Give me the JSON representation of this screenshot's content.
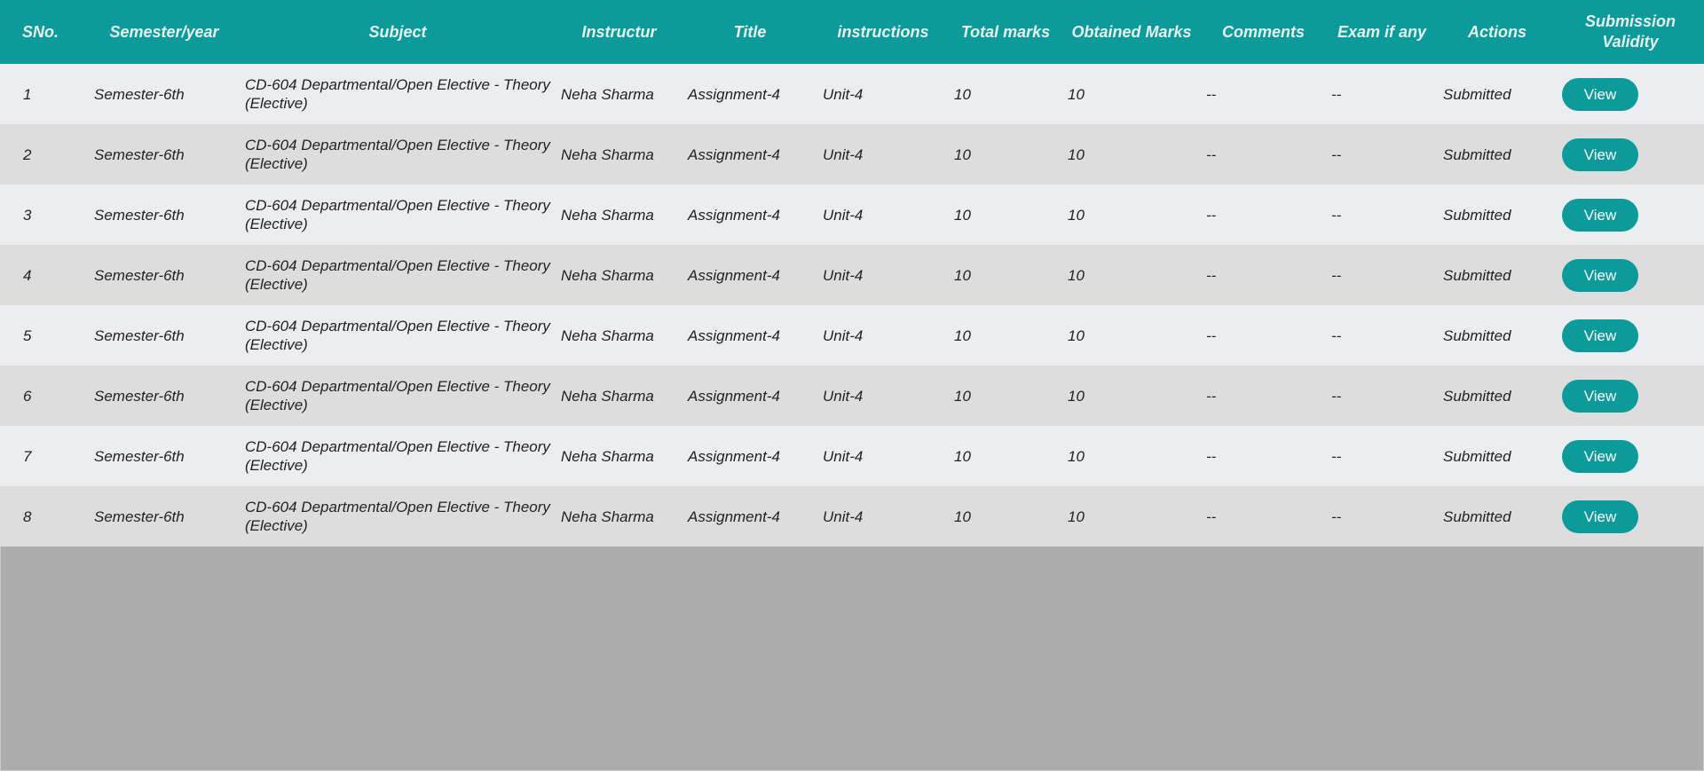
{
  "table": {
    "headers": [
      "SNo.",
      "Semester/year",
      "Subject",
      "Instructur",
      "Title",
      "instructions",
      "Total marks",
      "Obtained Marks",
      "Comments",
      "Exam if any",
      "Actions",
      "Submission Validity"
    ],
    "rows": [
      {
        "sno": "1",
        "semester": "Semester-6th",
        "subject": "CD-604 Departmental/Open Elective - Theory (Elective)",
        "instructor": "Neha Sharma",
        "title": "Assignment-4",
        "instructions": "Unit-4",
        "total": "10",
        "obtained": "10",
        "comments": "--",
        "exam": "--",
        "actions": "Submitted",
        "validity_button": "View"
      },
      {
        "sno": "2",
        "semester": "Semester-6th",
        "subject": "CD-604 Departmental/Open Elective - Theory (Elective)",
        "instructor": "Neha Sharma",
        "title": "Assignment-4",
        "instructions": "Unit-4",
        "total": "10",
        "obtained": "10",
        "comments": "--",
        "exam": "--",
        "actions": "Submitted",
        "validity_button": "View"
      },
      {
        "sno": "3",
        "semester": "Semester-6th",
        "subject": "CD-604 Departmental/Open Elective - Theory (Elective)",
        "instructor": "Neha Sharma",
        "title": "Assignment-4",
        "instructions": "Unit-4",
        "total": "10",
        "obtained": "10",
        "comments": "--",
        "exam": "--",
        "actions": "Submitted",
        "validity_button": "View"
      },
      {
        "sno": "4",
        "semester": "Semester-6th",
        "subject": "CD-604 Departmental/Open Elective - Theory (Elective)",
        "instructor": "Neha Sharma",
        "title": "Assignment-4",
        "instructions": "Unit-4",
        "total": "10",
        "obtained": "10",
        "comments": "--",
        "exam": "--",
        "actions": "Submitted",
        "validity_button": "View"
      },
      {
        "sno": "5",
        "semester": "Semester-6th",
        "subject": "CD-604 Departmental/Open Elective - Theory (Elective)",
        "instructor": "Neha Sharma",
        "title": "Assignment-4",
        "instructions": "Unit-4",
        "total": "10",
        "obtained": "10",
        "comments": "--",
        "exam": "--",
        "actions": "Submitted",
        "validity_button": "View"
      },
      {
        "sno": "6",
        "semester": "Semester-6th",
        "subject": "CD-604 Departmental/Open Elective - Theory (Elective)",
        "instructor": "Neha Sharma",
        "title": "Assignment-4",
        "instructions": "Unit-4",
        "total": "10",
        "obtained": "10",
        "comments": "--",
        "exam": "--",
        "actions": "Submitted",
        "validity_button": "View"
      },
      {
        "sno": "7",
        "semester": "Semester-6th",
        "subject": "CD-604 Departmental/Open Elective - Theory (Elective)",
        "instructor": "Neha Sharma",
        "title": "Assignment-4",
        "instructions": "Unit-4",
        "total": "10",
        "obtained": "10",
        "comments": "--",
        "exam": "--",
        "actions": "Submitted",
        "validity_button": "View"
      },
      {
        "sno": "8",
        "semester": "Semester-6th",
        "subject": "CD-604 Departmental/Open Elective - Theory (Elective)",
        "instructor": "Neha Sharma",
        "title": "Assignment-4",
        "instructions": "Unit-4",
        "total": "10",
        "obtained": "10",
        "comments": "--",
        "exam": "--",
        "actions": "Submitted",
        "validity_button": "View"
      }
    ]
  },
  "colors": {
    "header_bg": "#0d9a9a",
    "row_odd": "#ecedf1",
    "row_even": "#dddddd",
    "page_bg": "#abacab",
    "button_bg": "#0d9a9a"
  }
}
